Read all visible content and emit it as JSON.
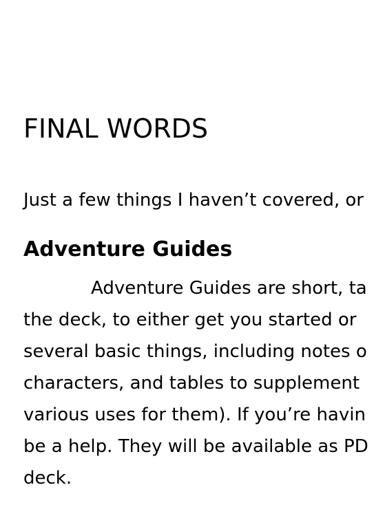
{
  "heading": "FINAL WORDS",
  "intro": "Just a few things I haven’t covered, or",
  "section_title": "Adventure Guides",
  "paragraph_lines": [
    "Adventure Guides are short, ta",
    "the deck, to either get you started or",
    "several basic things, including notes o",
    "characters, and tables to supplement",
    "various uses for them). If you’re havin",
    "be a help. They will be available as PD",
    "deck."
  ]
}
